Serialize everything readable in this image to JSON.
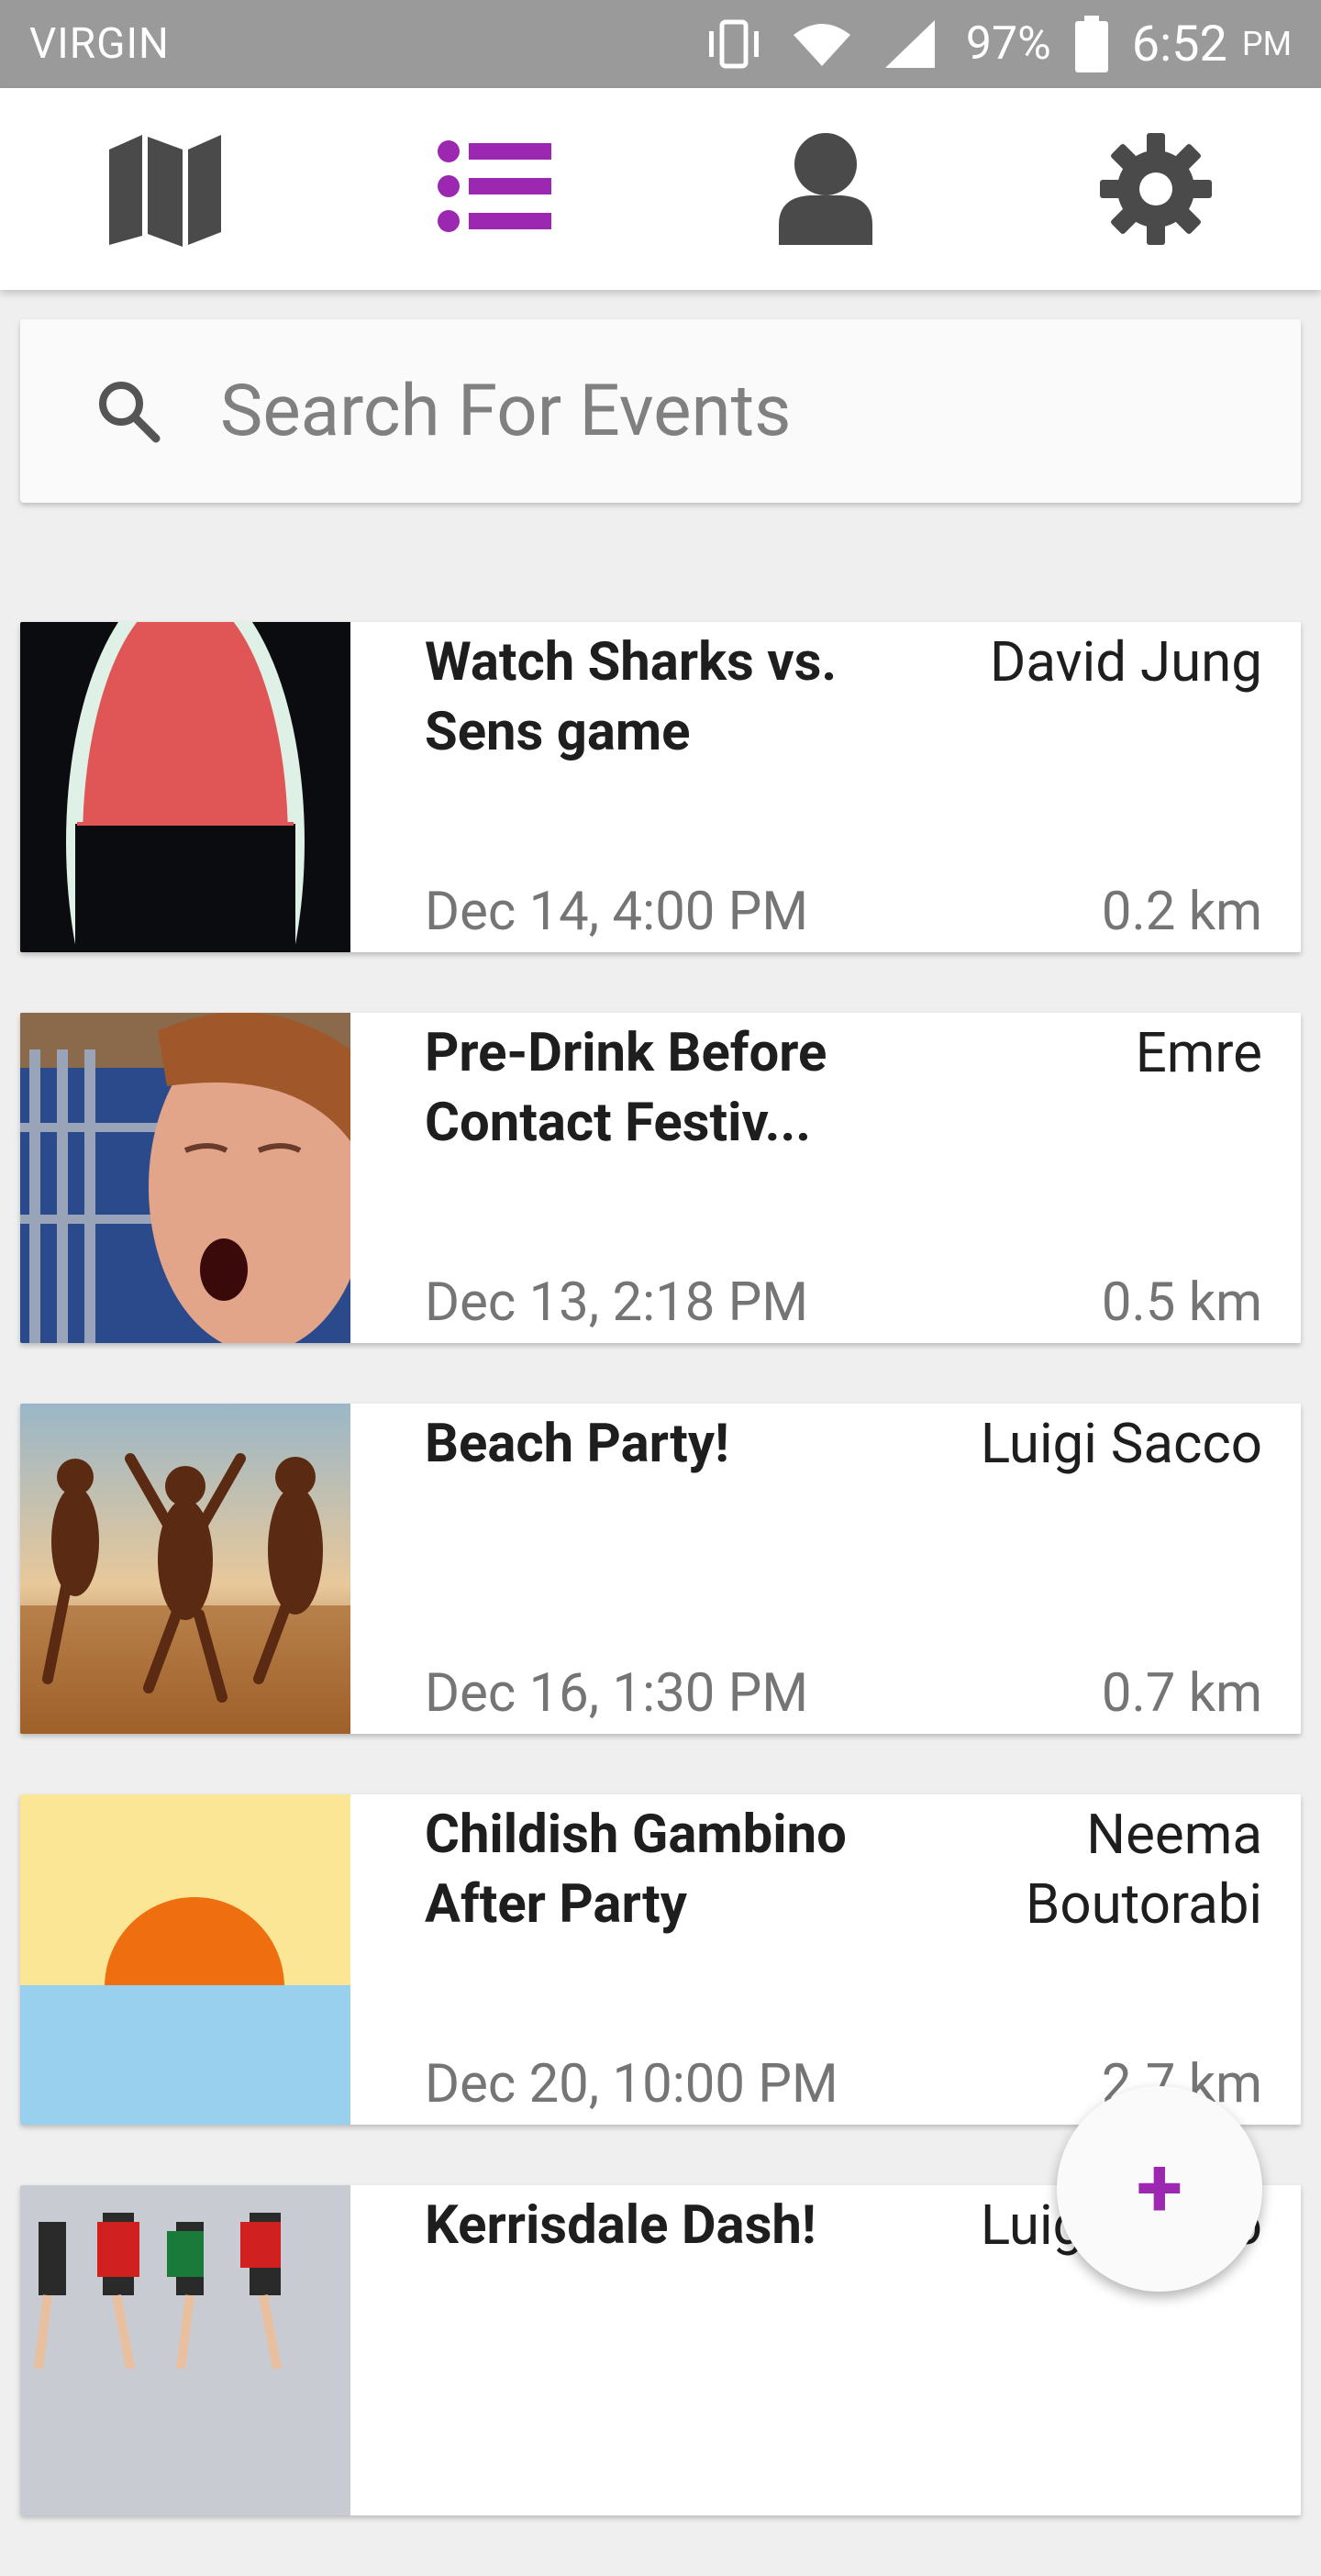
{
  "status_bar": {
    "carrier": "VIRGIN",
    "battery": "97%",
    "time": "6:52",
    "ampm": "PM"
  },
  "tabs": [
    {
      "name": "map",
      "icon": "map-icon",
      "active": false
    },
    {
      "name": "list",
      "icon": "list-icon",
      "active": true
    },
    {
      "name": "profile",
      "icon": "person-icon",
      "active": false
    },
    {
      "name": "settings",
      "icon": "gear-icon",
      "active": false
    }
  ],
  "colors": {
    "accent": "#9c27b0",
    "icon_inactive": "#4a4a4a",
    "status_bar": "#9a9a9a"
  },
  "search": {
    "placeholder": "Search For Events",
    "value": ""
  },
  "events": [
    {
      "title": "Watch Sharks vs. Sens game",
      "host": "David Jung",
      "date": "Dec 14, 4:00 PM",
      "distance": "0.2 km"
    },
    {
      "title": "Pre-Drink Before Contact Festiv...",
      "host": "Emre",
      "date": "Dec 13, 2:18 PM",
      "distance": "0.5 km"
    },
    {
      "title": "Beach Party!",
      "host": "Luigi Sacco",
      "date": "Dec 16, 1:30 PM",
      "distance": "0.7 km"
    },
    {
      "title": "Childish Gambino After Party",
      "host": "Neema Boutorabi",
      "date": "Dec 20, 10:00 PM",
      "distance": "2.7 km"
    },
    {
      "title": "Kerrisdale Dash!",
      "host": "Luigi Sacco",
      "date": "",
      "distance": ""
    }
  ],
  "fab": {
    "label": "+"
  }
}
